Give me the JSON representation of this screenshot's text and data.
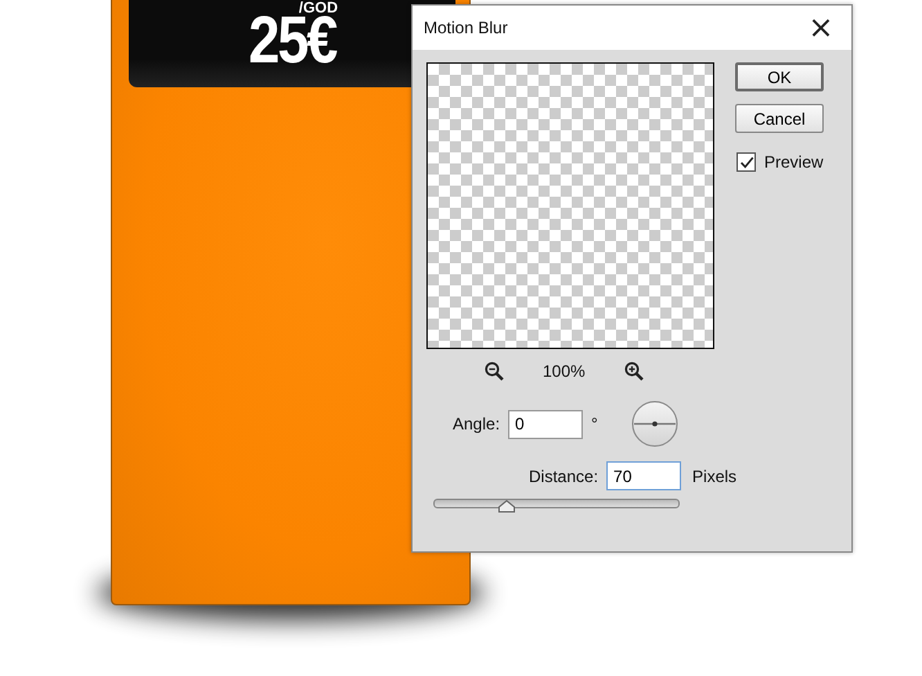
{
  "artwork": {
    "price": "25€",
    "period": "/GOD"
  },
  "dialog": {
    "title": "Motion Blur",
    "close": "×",
    "buttons": [
      {
        "label": "OK",
        "default": true
      },
      {
        "label": "Cancel",
        "default": false
      }
    ],
    "preview": {
      "label": "Preview",
      "checked": true
    },
    "zoom": "100%",
    "angle": {
      "label": "Angle:",
      "value": "0",
      "unit": "°"
    },
    "distance": {
      "label": "Distance:",
      "value": "70",
      "unit": "Pixels",
      "focused": true,
      "level": 0.3
    }
  }
}
